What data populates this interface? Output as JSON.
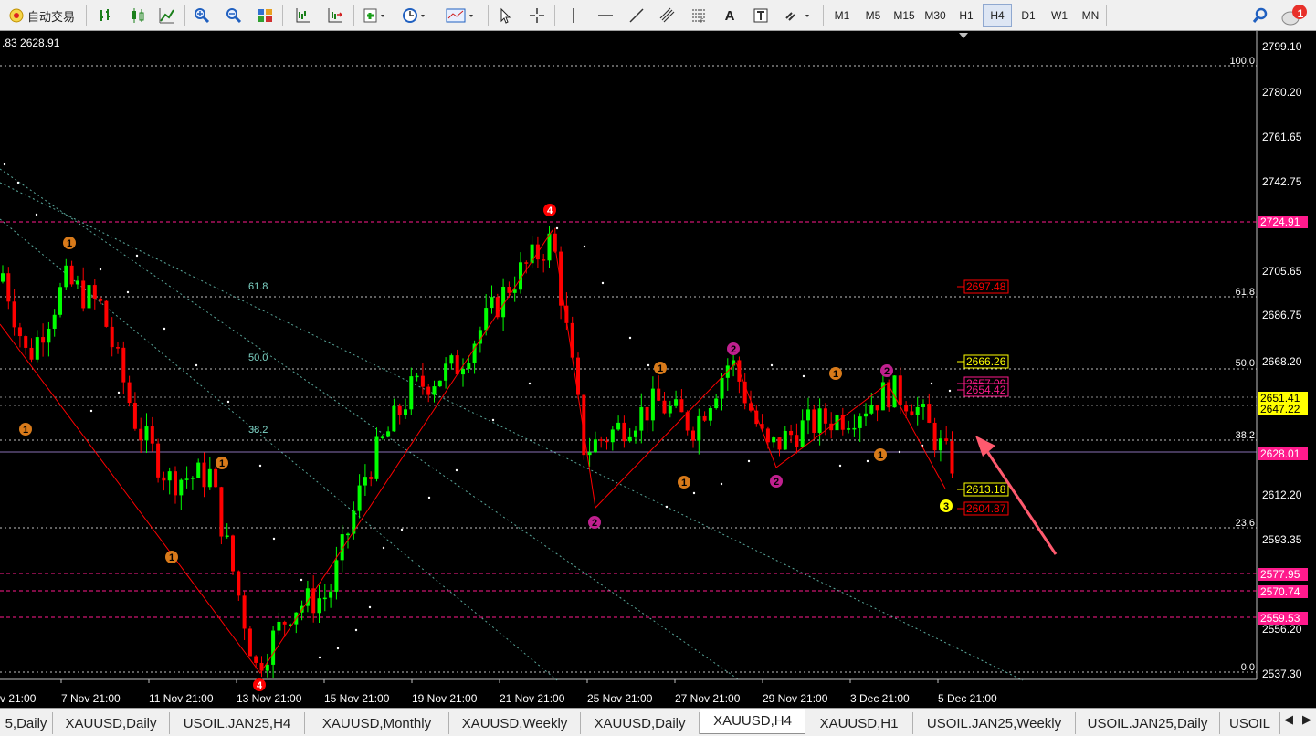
{
  "toolbar": {
    "autotrade_label": "自动交易",
    "timeframes": [
      "M1",
      "M5",
      "M15",
      "M30",
      "H1",
      "H4",
      "D1",
      "W1",
      "MN"
    ],
    "active_timeframe": "H4",
    "notification_count": "1"
  },
  "chart": {
    "header_price": ".83 2628.91",
    "price_axis": [
      "2799.10",
      "2780.20",
      "2761.65",
      "2742.75",
      "2724.91",
      "2705.65",
      "2686.75",
      "2668.20",
      "2651.41",
      "2647.22",
      "2628.01",
      "2612.20",
      "2593.35",
      "2577.95",
      "2570.74",
      "2559.53",
      "2556.20",
      "2537.30"
    ],
    "time_axis": [
      "v 21:00",
      "7 Nov 21:00",
      "11 Nov 21:00",
      "13 Nov 21:00",
      "15 Nov 21:00",
      "19 Nov 21:00",
      "21 Nov 21:00",
      "25 Nov 21:00",
      "27 Nov 21:00",
      "29 Nov 21:00",
      "3 Dec 21:00",
      "5 Dec 21:00"
    ],
    "fib_left": [
      "61.8",
      "50.0",
      "38.2"
    ],
    "fib_right": [
      "100.0",
      "61.8",
      "50.0",
      "38.2",
      "23.6",
      "0.0"
    ],
    "price_tags": [
      "2724.91",
      "2697.48",
      "2666.26",
      "2657.09",
      "2654.42",
      "2651.41",
      "2647.22",
      "2628.01",
      "2613.18",
      "2604.87",
      "2577.95",
      "2570.74",
      "2559.53"
    ],
    "wave_labels": [
      "4",
      "3",
      "2",
      "1",
      "4"
    ],
    "colors": {
      "bull": "#00ff00",
      "bear": "#ff0000",
      "fib": "#ffffff",
      "pink": "#ff1a8c",
      "yellow": "#ffff00",
      "arrow": "#ff5a6e"
    }
  },
  "tabs": [
    "5,Daily",
    "XAUUSD,Daily",
    "USOIL.JAN25,H4",
    "XAUUSD,Monthly",
    "XAUUSD,Weekly",
    "XAUUSD,Daily",
    "XAUUSD,H4",
    "XAUUSD,H1",
    "USOIL.JAN25,Weekly",
    "USOIL.JAN25,Daily",
    "USOIL"
  ],
  "active_tab": "XAUUSD,H4",
  "tab_scroll": [
    "◀",
    "▶"
  ]
}
